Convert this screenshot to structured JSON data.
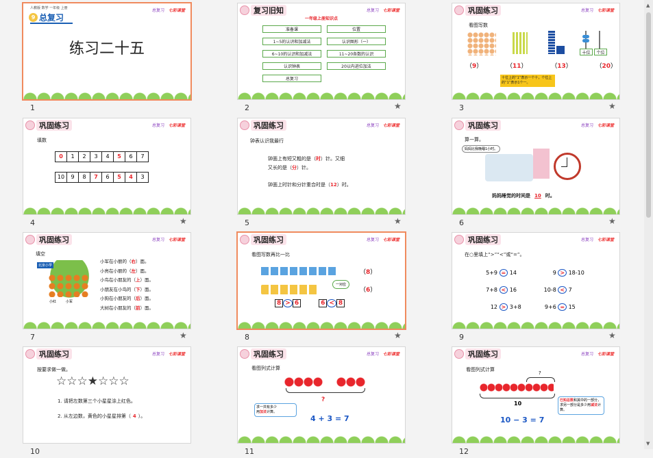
{
  "slides": [
    {
      "number": "1",
      "unit": "9",
      "unit_title": "总复习",
      "title": "练习二十五",
      "top_tags": "人教版 数学 一年级 上册"
    },
    {
      "number": "2",
      "header": "复习旧知",
      "subtitle": "一年级上册知识点",
      "items": [
        "准备课",
        "位置",
        "1~5的认识和加减法",
        "认识图形（一）",
        "6~10的认识和加减法",
        "11~20各数的认识",
        "认识钟表",
        "20以内进位加法",
        "总复习"
      ]
    },
    {
      "number": "3",
      "header": "巩固练习",
      "prompt": "看图写数",
      "answers": [
        "9",
        "11",
        "13",
        "20"
      ],
      "note": "十位上的“1”表示一个十，个位上的“1”表示1个一。",
      "abacus_labels": [
        "十位",
        "个位"
      ]
    },
    {
      "number": "4",
      "header": "巩固练习",
      "prompt": "填数",
      "row1": [
        "0",
        "1",
        "2",
        "3",
        "4",
        "5",
        "6",
        "7"
      ],
      "row2": [
        "10",
        "9",
        "8",
        "7",
        "6",
        "5",
        "4",
        "3"
      ]
    },
    {
      "number": "5",
      "header": "巩固练习",
      "prompt": "钟表认识我最行",
      "line1a": "钟面上有短又粗的是（",
      "ans1": "时",
      "line1b": "）针。又细",
      "line2a": "又长的是（",
      "ans2": "分",
      "line2b": "）针。",
      "line3a": "钟面上时针和分针重合时是（",
      "ans3": "12",
      "line3b": "）时。"
    },
    {
      "number": "6",
      "header": "巩固练习",
      "prompt": "算一算。",
      "bubble": "妈妈比我晚睡1小时。",
      "answer_pre": "妈妈睡觉的时间是",
      "answer": "10",
      "answer_post": "时。"
    },
    {
      "number": "7",
      "header": "巩固练习",
      "prompt": "填空",
      "sign": "北京小学",
      "kid_labels": [
        "小红",
        "小军"
      ],
      "lines": [
        [
          "小军在小丽的（",
          "右",
          "）面。"
        ],
        [
          "小亮在小丽的（",
          "左",
          "）面。"
        ],
        [
          "小鸟在小朋友的（",
          "上",
          "）面。"
        ],
        [
          "小朋友在小鸟的（",
          "下",
          "）面。"
        ],
        [
          "小狗在小朋友的（",
          "后",
          "）面。"
        ],
        [
          "大树在小朋友的（",
          "前",
          "）面。"
        ]
      ]
    },
    {
      "number": "8",
      "header": "巩固练习",
      "prompt": "看图写数再比一比",
      "a1": "8",
      "a2": "6",
      "tag": "一对应",
      "cmp1": [
        "8",
        ">",
        "6"
      ],
      "cmp2": [
        "6",
        "<",
        "8"
      ]
    },
    {
      "number": "9",
      "header": "巩固练习",
      "prompt": "在○里填上“>”“<”或“=”。",
      "rows": [
        [
          "5+9",
          "=",
          "14",
          "9",
          ">",
          "18-10"
        ],
        [
          "7+8",
          "<",
          "16",
          "10-8",
          "<",
          "7"
        ],
        [
          "12",
          ">",
          "3+8",
          "9+6",
          "=",
          "15"
        ]
      ]
    },
    {
      "number": "10",
      "header": "巩固练习",
      "prompt": "按要求做一做。",
      "stars": "☆☆☆★☆☆☆",
      "q1": "1. 请把左数第三个小星星涂上红色。",
      "q2a": "2. 从左边数，黄色的小星星排第（",
      "q2ans": "4",
      "q2b": "）。"
    },
    {
      "number": "11",
      "header": "巩固练习",
      "prompt": "看图列式计算",
      "q": "?",
      "hint_a": "求一共有多少",
      "hint_b": "用",
      "hint_red": "加法",
      "hint_c": "计算。",
      "eq": "4 + 3 = 7"
    },
    {
      "number": "12",
      "header": "巩固练习",
      "prompt": "看图列式计算",
      "q": "?",
      "total": "10",
      "hint_red1": "已知总数",
      "hint_a": "和其中的一部分，求另一部分是多少用",
      "hint_red2": "减法",
      "hint_b": "计算。",
      "eq": "10 − 3 = 7"
    }
  ],
  "brand_a": "总复习",
  "brand_b": "七彩课堂"
}
